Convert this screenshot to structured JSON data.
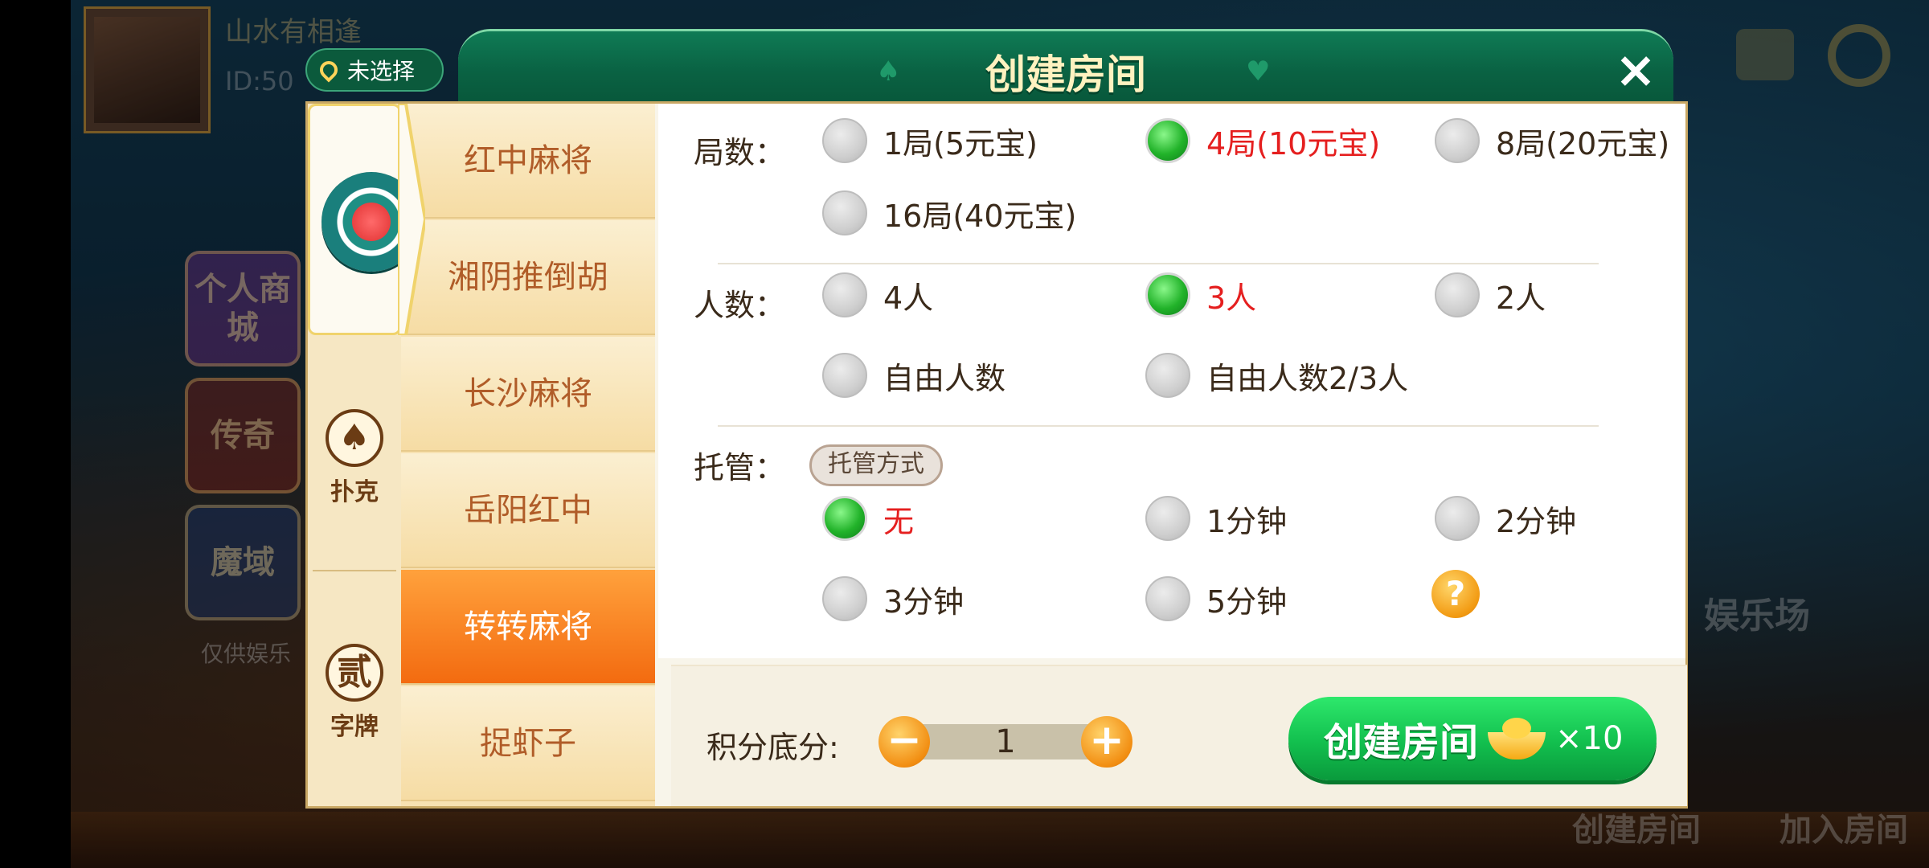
{
  "background": {
    "username": "山水有相逢",
    "id_text": "ID:50",
    "tiles": [
      "个人商城",
      "传奇",
      "魔域"
    ],
    "note": "仅供娱乐",
    "right_text": "娱乐场",
    "bottom_right_buttons": [
      "创建房间",
      "加入房间"
    ]
  },
  "dialog": {
    "title": "创建房间",
    "location_label": "未选择",
    "close_icon": "close-icon",
    "categories": [
      {
        "name": "mahjong",
        "label": ""
      },
      {
        "name": "poker",
        "label": "扑克",
        "icon_text": "♠"
      },
      {
        "name": "zipai",
        "label": "字牌",
        "icon_text": "贰"
      }
    ],
    "games": [
      "红中麻将",
      "湘阴推倒胡",
      "长沙麻将",
      "岳阳红中",
      "转转麻将",
      "捉虾子"
    ],
    "active_game_index": 4,
    "rounds": {
      "label": "局数：",
      "options": [
        "1局(5元宝)",
        "4局(10元宝)",
        "8局(20元宝)",
        "16局(40元宝)"
      ],
      "selected": "4局(10元宝)"
    },
    "players": {
      "label": "人数：",
      "options": [
        "4人",
        "3人",
        "2人",
        "自由人数",
        "自由人数2/3人"
      ],
      "selected": "3人"
    },
    "trustee": {
      "label": "托管：",
      "mode_pill": "托管方式",
      "options": [
        "无",
        "1分钟",
        "2分钟",
        "3分钟",
        "5分钟"
      ],
      "selected": "无",
      "help_text": "?"
    },
    "footer": {
      "score_label": "积分底分:",
      "score_value": "1",
      "minus": "−",
      "plus": "+",
      "create_label": "创建房间",
      "cost": "×10"
    }
  },
  "colors": {
    "accent_green": "#0a6243",
    "selected_text": "#e51f1f",
    "active_tab": "#f36b10"
  }
}
